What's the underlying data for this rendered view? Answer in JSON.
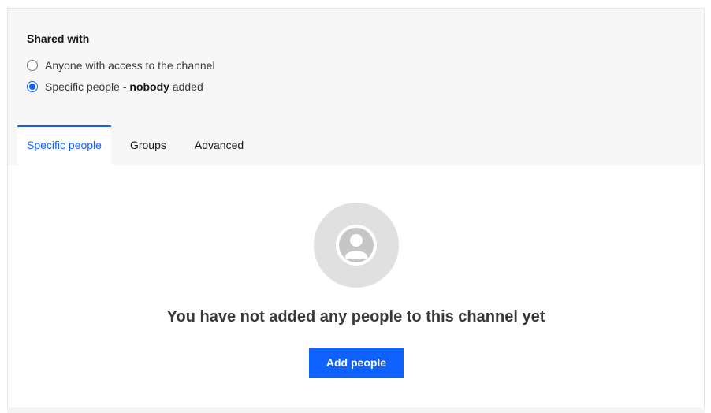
{
  "shared_with": {
    "title": "Shared with",
    "options": [
      {
        "label": "Anyone with access to the channel",
        "checked": false
      },
      {
        "label_prefix": "Specific people - ",
        "label_bold": "nobody",
        "label_suffix": " added",
        "checked": true
      }
    ]
  },
  "tabs": [
    {
      "label": "Specific people",
      "active": true
    },
    {
      "label": "Groups",
      "active": false
    },
    {
      "label": "Advanced",
      "active": false
    }
  ],
  "empty_state": {
    "icon": "user-avatar-icon",
    "message": "You have not added any people to this channel yet",
    "button_label": "Add people"
  },
  "colors": {
    "accent": "#0f62fe",
    "avatar_bg": "#e0e0e0",
    "top_bg": "#f7f7f7"
  }
}
